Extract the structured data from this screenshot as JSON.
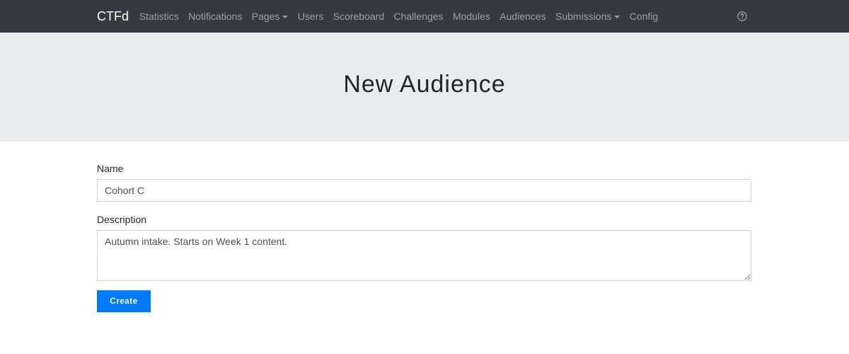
{
  "navbar": {
    "brand": "CTFd",
    "links": [
      {
        "label": "Statistics"
      },
      {
        "label": "Notifications"
      },
      {
        "label": "Pages"
      },
      {
        "label": "Users"
      },
      {
        "label": "Scoreboard"
      },
      {
        "label": "Challenges"
      },
      {
        "label": "Modules"
      },
      {
        "label": "Audiences"
      },
      {
        "label": "Submissions"
      },
      {
        "label": "Config"
      }
    ],
    "help_icon": "question-circle-icon"
  },
  "header": {
    "title": "New Audience"
  },
  "form": {
    "name_label": "Name",
    "name_value": "Cohort C",
    "description_label": "Description",
    "description_value": "Autumn intake. Starts on Week 1 content.",
    "submit_label": "Create"
  },
  "colors": {
    "navbar_bg": "#343a40",
    "jumbotron_bg": "#e9ecef",
    "primary": "#007bff"
  }
}
